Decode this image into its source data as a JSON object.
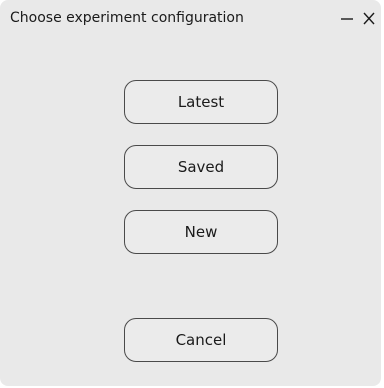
{
  "window": {
    "title": "Choose experiment configuration",
    "controls": {
      "minimize_icon": "minimize-icon",
      "close_icon": "close-icon"
    }
  },
  "buttons": {
    "latest": "Latest",
    "saved": "Saved",
    "new": "New",
    "cancel": "Cancel"
  },
  "colors": {
    "window_background": "#e9e9e9",
    "button_border": "#4a4a4a",
    "text": "#1a1a1a"
  }
}
